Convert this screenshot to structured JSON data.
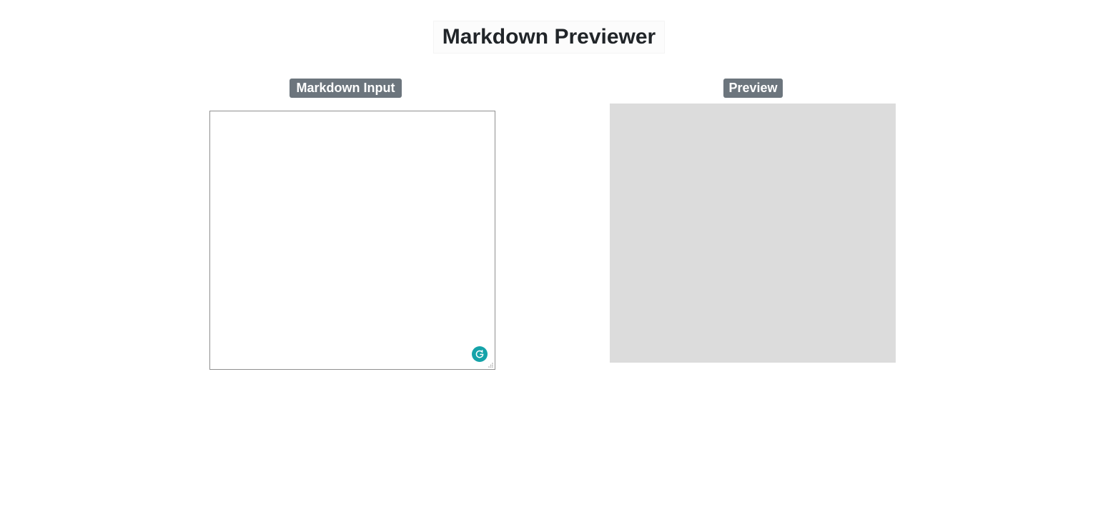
{
  "header": {
    "title": "Markdown Previewer"
  },
  "editor": {
    "label": "Markdown Input",
    "value": "",
    "assistant_icon": "grammarly-icon"
  },
  "preview": {
    "label": "Preview",
    "content": ""
  },
  "colors": {
    "label_bg": "#6c757d",
    "preview_bg": "#dcdcdc",
    "badge": "#15a3a9"
  }
}
